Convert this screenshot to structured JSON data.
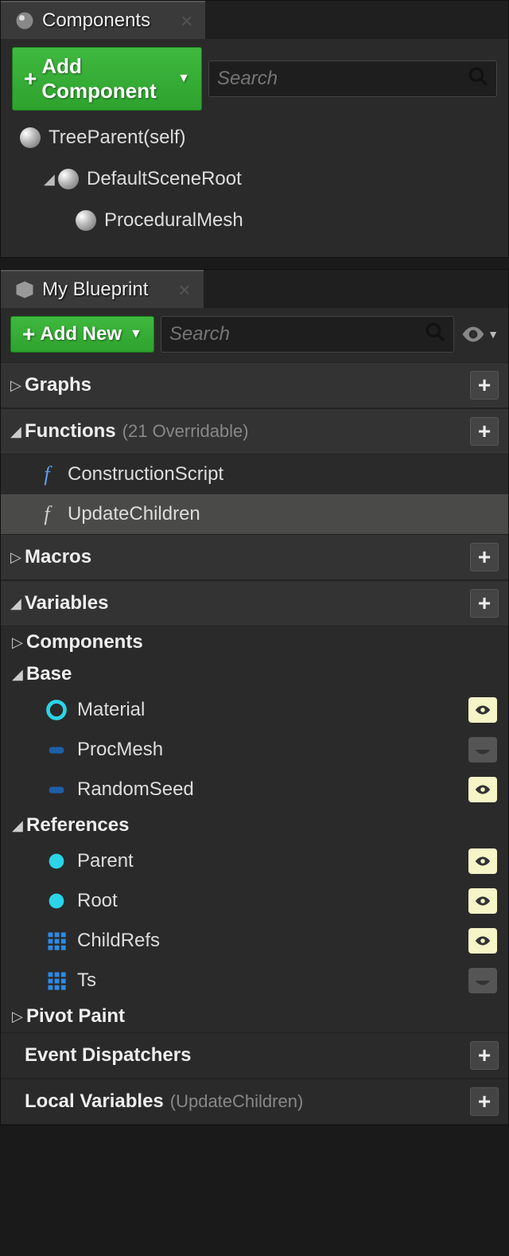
{
  "components_panel": {
    "tab_label": "Components",
    "add_button": "Add Component",
    "search_placeholder": "Search",
    "tree": {
      "root": "TreeParent(self)",
      "scene_root": "DefaultSceneRoot",
      "child1": "ProceduralMesh"
    }
  },
  "blueprint_panel": {
    "tab_label": "My Blueprint",
    "add_button": "Add New",
    "search_placeholder": "Search",
    "sections": {
      "graphs": "Graphs",
      "functions": {
        "title": "Functions",
        "sub": "(21 Overridable)",
        "items": {
          "construction": "ConstructionScript",
          "update": "UpdateChildren"
        }
      },
      "macros": "Macros",
      "variables": {
        "title": "Variables",
        "groups": {
          "components_label": "Components",
          "base_label": "Base",
          "base": {
            "material": "Material",
            "procmesh": "ProcMesh",
            "randomseed": "RandomSeed"
          },
          "references_label": "References",
          "references": {
            "parent": "Parent",
            "root": "Root",
            "childrefs": "ChildRefs",
            "ts": "Ts"
          },
          "pivot_label": "Pivot Paint"
        }
      },
      "event_dispatchers": "Event Dispatchers",
      "local_variables": {
        "title": "Local Variables",
        "sub": "(UpdateChildren)"
      }
    }
  }
}
